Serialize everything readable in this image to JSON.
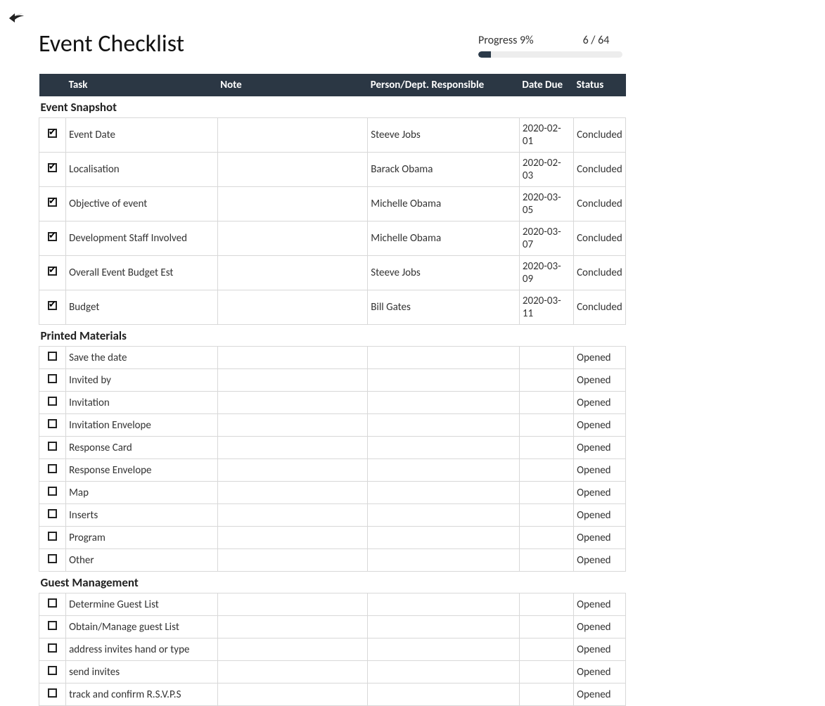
{
  "title": "Event Checklist",
  "progress": {
    "label": "Progress 9%",
    "count": "6 / 64",
    "percent": 9
  },
  "columns": {
    "check": "",
    "task": "Task",
    "note": "Note",
    "person": "Person/Dept. Responsible",
    "date": "Date Due",
    "status": "Status"
  },
  "sections": [
    {
      "title": "Event Snapshot",
      "rows": [
        {
          "checked": true,
          "task": "Event Date",
          "note": "",
          "person": "Steeve Jobs",
          "date": "2020-02-01",
          "status": "Concluded"
        },
        {
          "checked": true,
          "task": "Localisation",
          "note": "",
          "person": "Barack Obama",
          "date": "2020-02-03",
          "status": "Concluded"
        },
        {
          "checked": true,
          "task": "Objective of event",
          "note": "",
          "person": "Michelle Obama",
          "date": "2020-03-05",
          "status": "Concluded"
        },
        {
          "checked": true,
          "task": "Development Staff Involved",
          "note": "",
          "person": "Michelle Obama",
          "date": "2020-03-07",
          "status": "Concluded"
        },
        {
          "checked": true,
          "task": "Overall Event Budget Est",
          "note": "",
          "person": "Steeve Jobs",
          "date": "2020-03-09",
          "status": "Concluded"
        },
        {
          "checked": true,
          "task": "Budget",
          "note": "",
          "person": "Bill Gates",
          "date": "2020-03-11",
          "status": "Concluded"
        }
      ]
    },
    {
      "title": "Printed Materials",
      "rows": [
        {
          "checked": false,
          "task": "Save the date",
          "note": "",
          "person": "",
          "date": "",
          "status": "Opened"
        },
        {
          "checked": false,
          "task": "Invited by",
          "note": "",
          "person": "",
          "date": "",
          "status": "Opened"
        },
        {
          "checked": false,
          "task": "Invitation",
          "note": "",
          "person": "",
          "date": "",
          "status": "Opened"
        },
        {
          "checked": false,
          "task": "Invitation Envelope",
          "note": "",
          "person": "",
          "date": "",
          "status": "Opened"
        },
        {
          "checked": false,
          "task": "Response Card",
          "note": "",
          "person": "",
          "date": "",
          "status": "Opened"
        },
        {
          "checked": false,
          "task": "Response Envelope",
          "note": "",
          "person": "",
          "date": "",
          "status": "Opened"
        },
        {
          "checked": false,
          "task": "Map",
          "note": "",
          "person": "",
          "date": "",
          "status": "Opened"
        },
        {
          "checked": false,
          "task": "Inserts",
          "note": "",
          "person": "",
          "date": "",
          "status": "Opened"
        },
        {
          "checked": false,
          "task": "Program",
          "note": "",
          "person": "",
          "date": "",
          "status": "Opened"
        },
        {
          "checked": false,
          "task": "Other",
          "note": "",
          "person": "",
          "date": "",
          "status": "Opened"
        }
      ]
    },
    {
      "title": "Guest Management",
      "rows": [
        {
          "checked": false,
          "task": "Determine Guest List",
          "note": "",
          "person": "",
          "date": "",
          "status": "Opened"
        },
        {
          "checked": false,
          "task": "Obtain/Manage guest List",
          "note": "",
          "person": "",
          "date": "",
          "status": "Opened"
        },
        {
          "checked": false,
          "task": "address invites hand or type",
          "note": "",
          "person": "",
          "date": "",
          "status": "Opened"
        },
        {
          "checked": false,
          "task": "send invites",
          "note": "",
          "person": "",
          "date": "",
          "status": "Opened"
        },
        {
          "checked": false,
          "task": "track and confirm R.S.V.P.S",
          "note": "",
          "person": "",
          "date": "",
          "status": "Opened"
        }
      ]
    }
  ]
}
